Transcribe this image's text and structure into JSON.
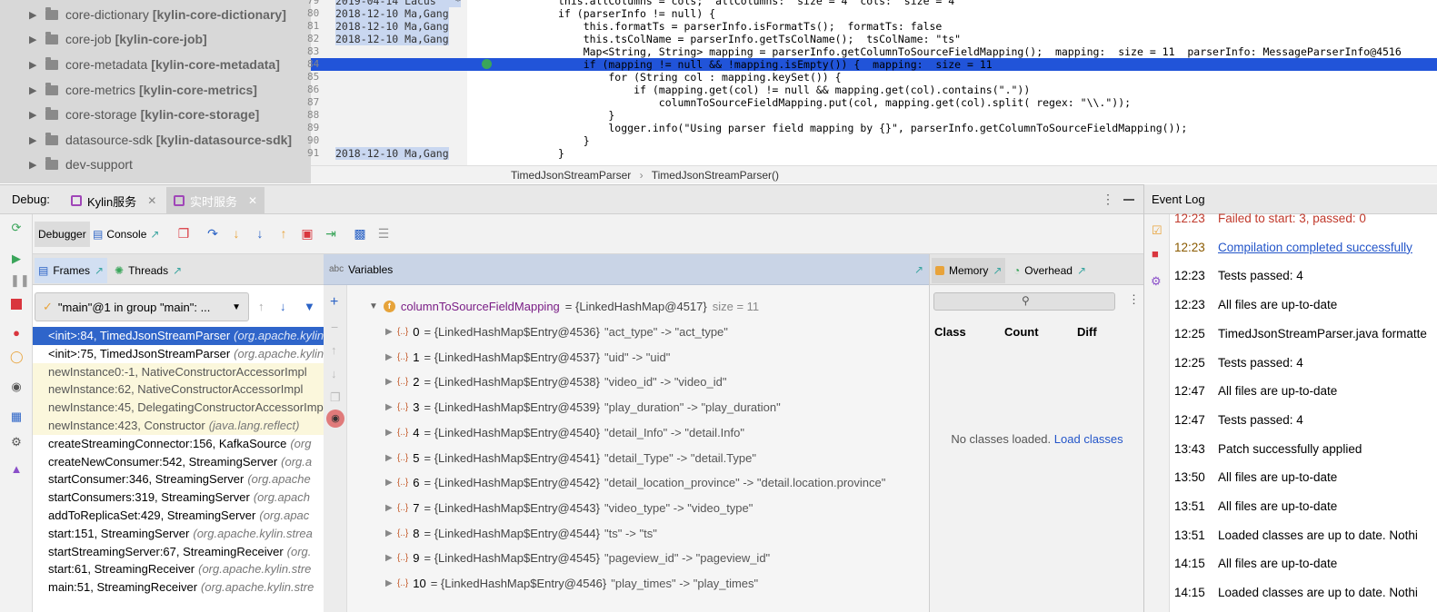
{
  "project_tree": [
    {
      "name": "core-dictionary",
      "module": "[kylin-core-dictionary]",
      "expandable": true
    },
    {
      "name": "core-job",
      "module": "[kylin-core-job]",
      "expandable": true
    },
    {
      "name": "core-metadata",
      "module": "[kylin-core-metadata]",
      "expandable": true
    },
    {
      "name": "core-metrics",
      "module": "[kylin-core-metrics]",
      "expandable": true
    },
    {
      "name": "core-storage",
      "module": "[kylin-core-storage]",
      "expandable": true
    },
    {
      "name": "datasource-sdk",
      "module": "[kylin-datasource-sdk]",
      "expandable": true
    },
    {
      "name": "dev-support",
      "module": "",
      "expandable": false
    }
  ],
  "editor": {
    "lines": [
      {
        "num": "79",
        "ann": "2019-04-14 Lacus   *",
        "code": "this.allColumns = cols;  allColumns:  size = 4  cols:  size = 4"
      },
      {
        "num": "80",
        "ann": "2018-12-10 Ma,Gang",
        "code": "if (parserInfo != null) {"
      },
      {
        "num": "81",
        "ann": "2018-12-10 Ma,Gang",
        "code": "    this.formatTs = parserInfo.isFormatTs();  formatTs: false"
      },
      {
        "num": "82",
        "ann": "2018-12-10 Ma,Gang",
        "code": "    this.tsColName = parserInfo.getTsColName();  tsColName: \"ts\""
      },
      {
        "num": "83",
        "ann": "",
        "code": "    Map<String, String> mapping = parserInfo.getColumnToSourceFieldMapping();  mapping:  size = 11  parserInfo: MessageParserInfo@4516"
      },
      {
        "num": "84",
        "ann": "",
        "code": "    if (mapping != null && !mapping.isEmpty()) {  mapping:  size = 11"
      },
      {
        "num": "85",
        "ann": "",
        "code": "        for (String col : mapping.keySet()) {"
      },
      {
        "num": "86",
        "ann": "",
        "code": "            if (mapping.get(col) != null && mapping.get(col).contains(\".\"))"
      },
      {
        "num": "87",
        "ann": "",
        "code": "                columnToSourceFieldMapping.put(col, mapping.get(col).split( regex: \"\\\\.\"));"
      },
      {
        "num": "88",
        "ann": "",
        "code": "        }"
      },
      {
        "num": "89",
        "ann": "",
        "code": "        logger.info(\"Using parser field mapping by {}\", parserInfo.getColumnToSourceFieldMapping());"
      },
      {
        "num": "90",
        "ann": "",
        "code": "    }"
      },
      {
        "num": "91",
        "ann": "2018-12-10 Ma,Gang",
        "code": "}"
      }
    ],
    "breadcrumbs": [
      "TimedJsonStreamParser",
      "TimedJsonStreamParser()"
    ]
  },
  "debug": {
    "title": "Debug:",
    "run_tabs": [
      "Kylin服务",
      "实时服务"
    ],
    "toolbar_tabs": [
      "Debugger",
      "Console"
    ]
  },
  "frames": {
    "tabs": [
      "Frames",
      "Threads"
    ],
    "thread": "\"main\"@1 in group \"main\": ...",
    "items": [
      {
        "method": "<init>:84, TimedJsonStreamParser",
        "pkg": "(org.apache.kylin",
        "kind": "selected"
      },
      {
        "method": "<init>:75, TimedJsonStreamParser",
        "pkg": "(org.apache.kylin",
        "kind": "normal"
      },
      {
        "method": "newInstance0:-1, NativeConstructorAccessorImpl",
        "pkg": "",
        "kind": "lib"
      },
      {
        "method": "newInstance:62, NativeConstructorAccessorImpl",
        "pkg": "",
        "kind": "lib"
      },
      {
        "method": "newInstance:45, DelegatingConstructorAccessorImpl",
        "pkg": "",
        "kind": "lib"
      },
      {
        "method": "newInstance:423, Constructor",
        "pkg": "(java.lang.reflect)",
        "kind": "lib"
      },
      {
        "method": "createStreamingConnector:156, KafkaSource",
        "pkg": "(org",
        "kind": "normal"
      },
      {
        "method": "createNewConsumer:542, StreamingServer",
        "pkg": "(org.a",
        "kind": "normal"
      },
      {
        "method": "startConsumer:346, StreamingServer",
        "pkg": "(org.apache",
        "kind": "normal"
      },
      {
        "method": "startConsumers:319, StreamingServer",
        "pkg": "(org.apach",
        "kind": "normal"
      },
      {
        "method": "addToReplicaSet:429, StreamingServer",
        "pkg": "(org.apac",
        "kind": "normal"
      },
      {
        "method": "start:151, StreamingServer",
        "pkg": "(org.apache.kylin.strea",
        "kind": "normal"
      },
      {
        "method": "startStreamingServer:67, StreamingReceiver",
        "pkg": "(org.",
        "kind": "normal"
      },
      {
        "method": "start:61, StreamingReceiver",
        "pkg": "(org.apache.kylin.stre",
        "kind": "normal"
      },
      {
        "method": "main:51, StreamingReceiver",
        "pkg": "(org.apache.kylin.stre",
        "kind": "normal"
      }
    ]
  },
  "variables": {
    "title": "Variables",
    "root": {
      "name": "columnToSourceFieldMapping",
      "value": "= {LinkedHashMap@4517}",
      "size": "size = 11"
    },
    "entries": [
      {
        "idx": "0",
        "ref": "= {LinkedHashMap$Entry@4536}",
        "kv": "\"act_type\" -> \"act_type\""
      },
      {
        "idx": "1",
        "ref": "= {LinkedHashMap$Entry@4537}",
        "kv": "\"uid\" -> \"uid\""
      },
      {
        "idx": "2",
        "ref": "= {LinkedHashMap$Entry@4538}",
        "kv": "\"video_id\" -> \"video_id\""
      },
      {
        "idx": "3",
        "ref": "= {LinkedHashMap$Entry@4539}",
        "kv": "\"play_duration\" -> \"play_duration\""
      },
      {
        "idx": "4",
        "ref": "= {LinkedHashMap$Entry@4540}",
        "kv": "\"detail_Info\" -> \"detail.Info\""
      },
      {
        "idx": "5",
        "ref": "= {LinkedHashMap$Entry@4541}",
        "kv": "\"detail_Type\" -> \"detail.Type\""
      },
      {
        "idx": "6",
        "ref": "= {LinkedHashMap$Entry@4542}",
        "kv": "\"detail_location_province\" -> \"detail.location.province\""
      },
      {
        "idx": "7",
        "ref": "= {LinkedHashMap$Entry@4543}",
        "kv": "\"video_type\" -> \"video_type\""
      },
      {
        "idx": "8",
        "ref": "= {LinkedHashMap$Entry@4544}",
        "kv": "\"ts\" -> \"ts\""
      },
      {
        "idx": "9",
        "ref": "= {LinkedHashMap$Entry@4545}",
        "kv": "\"pageview_id\" -> \"pageview_id\""
      },
      {
        "idx": "10",
        "ref": "= {LinkedHashMap$Entry@4546}",
        "kv": "\"play_times\" -> \"play_times\""
      }
    ]
  },
  "memory": {
    "tabs": [
      "Memory",
      "Overhead"
    ],
    "columns": [
      "Class",
      "Count",
      "Diff"
    ],
    "empty_text": "No classes loaded.",
    "load_link": "Load classes"
  },
  "event_log": {
    "title": "Event Log",
    "entries": [
      {
        "time": "12:23",
        "msg": "Failed to start: 3, passed: 0",
        "kind": "err"
      },
      {
        "time": "12:23",
        "msg": "Compilation completed successfully",
        "kind": "link"
      },
      {
        "time": "12:23",
        "msg": "Tests passed: 4",
        "kind": "normal"
      },
      {
        "time": "12:23",
        "msg": "All files are up-to-date",
        "kind": "normal"
      },
      {
        "time": "12:25",
        "msg": "TimedJsonStreamParser.java formatte",
        "kind": "normal"
      },
      {
        "time": "12:25",
        "msg": "Tests passed: 4",
        "kind": "normal"
      },
      {
        "time": "12:47",
        "msg": "All files are up-to-date",
        "kind": "normal"
      },
      {
        "time": "12:47",
        "msg": "Tests passed: 4",
        "kind": "normal"
      },
      {
        "time": "13:43",
        "msg": "Patch successfully applied",
        "kind": "normal"
      },
      {
        "time": "13:50",
        "msg": "All files are up-to-date",
        "kind": "normal"
      },
      {
        "time": "13:51",
        "msg": "All files are up-to-date",
        "kind": "normal"
      },
      {
        "time": "13:51",
        "msg": "Loaded classes are up to date. Nothi",
        "kind": "normal"
      },
      {
        "time": "14:15",
        "msg": "All files are up-to-date",
        "kind": "normal"
      },
      {
        "time": "14:15",
        "msg": "Loaded classes are up to date. Nothi",
        "kind": "normal"
      }
    ]
  }
}
